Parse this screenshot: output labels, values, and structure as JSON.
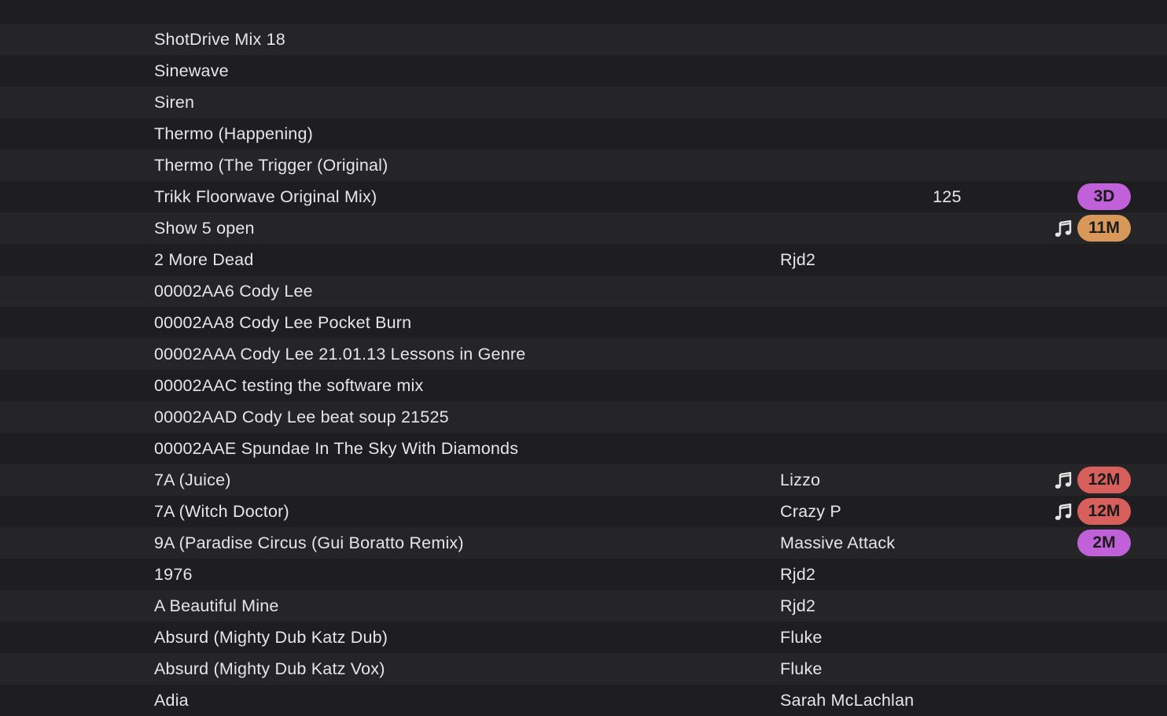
{
  "colors": {
    "row_even": "#1e1e20",
    "row_odd": "#252527",
    "text": "#e6e6e6",
    "badge_purple": "#c061d9",
    "badge_orange": "#d8985a",
    "badge_red": "#d8605c"
  },
  "tracks": [
    {
      "title": "",
      "artist": "",
      "bpm": "",
      "note_icon": false,
      "badge": null
    },
    {
      "title": "ShotDrive Mix 18",
      "artist": "",
      "bpm": "",
      "note_icon": false,
      "badge": null
    },
    {
      "title": "Sinewave",
      "artist": "",
      "bpm": "",
      "note_icon": false,
      "badge": null
    },
    {
      "title": "Siren",
      "artist": "",
      "bpm": "",
      "note_icon": false,
      "badge": null
    },
    {
      "title": "Thermo (Happening)",
      "artist": "",
      "bpm": "",
      "note_icon": false,
      "badge": null
    },
    {
      "title": "Thermo (The Trigger (Original)",
      "artist": "",
      "bpm": "",
      "note_icon": false,
      "badge": null
    },
    {
      "title": "Trikk Floorwave Original Mix)",
      "artist": "",
      "bpm": "125",
      "note_icon": false,
      "badge": {
        "label": "3D",
        "color": "#c061d9"
      }
    },
    {
      "title": "Show 5 open",
      "artist": "",
      "bpm": "",
      "note_icon": true,
      "badge": {
        "label": "11M",
        "color": "#d8985a"
      }
    },
    {
      "title": "2 More Dead",
      "artist": "Rjd2",
      "bpm": "",
      "note_icon": false,
      "badge": null
    },
    {
      "title": "00002AA6 Cody Lee",
      "artist": "",
      "bpm": "",
      "note_icon": false,
      "badge": null
    },
    {
      "title": "00002AA8 Cody Lee Pocket Burn",
      "artist": "",
      "bpm": "",
      "note_icon": false,
      "badge": null
    },
    {
      "title": "00002AAA Cody Lee 21.01.13 Lessons in Genre",
      "artist": "",
      "bpm": "",
      "note_icon": false,
      "badge": null
    },
    {
      "title": "00002AAC testing the software mix",
      "artist": "",
      "bpm": "",
      "note_icon": false,
      "badge": null
    },
    {
      "title": "00002AAD Cody Lee beat soup 21525",
      "artist": "",
      "bpm": "",
      "note_icon": false,
      "badge": null
    },
    {
      "title": "00002AAE Spundae In The Sky With Diamonds",
      "artist": "",
      "bpm": "",
      "note_icon": false,
      "badge": null
    },
    {
      "title": "7A (Juice)",
      "artist": "Lizzo",
      "bpm": "",
      "note_icon": true,
      "badge": {
        "label": "12M",
        "color": "#d8605c"
      }
    },
    {
      "title": "7A (Witch Doctor)",
      "artist": "Crazy P",
      "bpm": "",
      "note_icon": true,
      "badge": {
        "label": "12M",
        "color": "#d8605c"
      }
    },
    {
      "title": "9A (Paradise Circus (Gui Boratto Remix)",
      "artist": "Massive Attack",
      "bpm": "",
      "note_icon": false,
      "badge": {
        "label": "2M",
        "color": "#c061d9"
      }
    },
    {
      "title": "1976",
      "artist": "Rjd2",
      "bpm": "",
      "note_icon": false,
      "badge": null
    },
    {
      "title": "A Beautiful Mine",
      "artist": "Rjd2",
      "bpm": "",
      "note_icon": false,
      "badge": null
    },
    {
      "title": "Absurd (Mighty Dub Katz Dub)",
      "artist": "Fluke",
      "bpm": "",
      "note_icon": false,
      "badge": null
    },
    {
      "title": "Absurd (Mighty Dub Katz Vox)",
      "artist": "Fluke",
      "bpm": "",
      "note_icon": false,
      "badge": null
    },
    {
      "title": "Adia",
      "artist": "Sarah McLachlan",
      "bpm": "",
      "note_icon": false,
      "badge": null
    }
  ]
}
